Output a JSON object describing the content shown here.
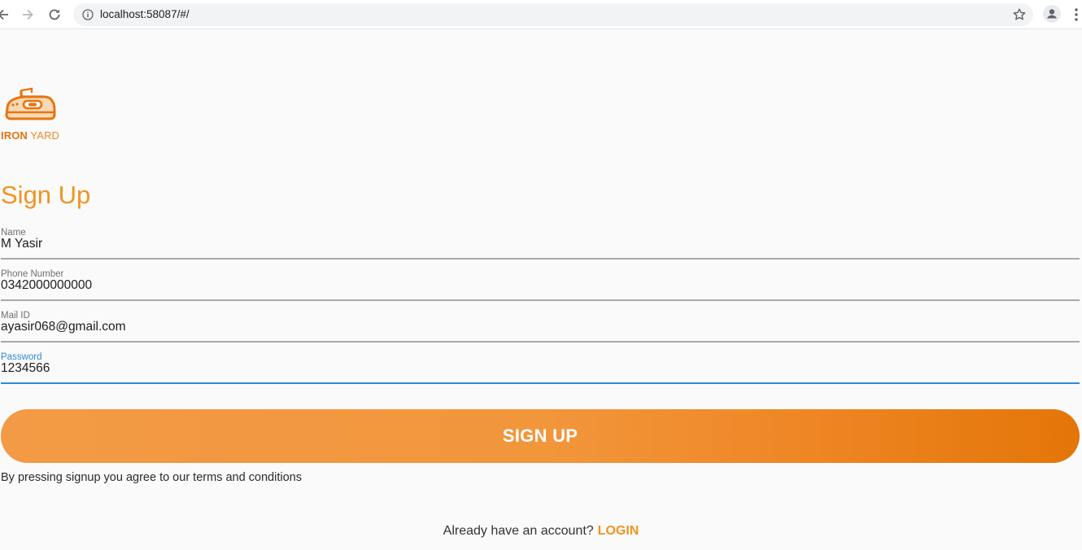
{
  "browser": {
    "url": "localhost:58087/#/",
    "icons": [
      "back-arrow-icon",
      "forward-arrow-icon",
      "reload-icon",
      "info-icon",
      "star-icon",
      "profile-icon",
      "more-menu-icon"
    ]
  },
  "brand": {
    "word1": "IRON",
    "word2": "YARD",
    "logo_icon": "iron-icon",
    "color_primary": "#e67510",
    "color_accent": "#f0941f"
  },
  "page": {
    "title": "Sign Up"
  },
  "form": {
    "name": {
      "label": "Name",
      "value": "M Yasir"
    },
    "phone": {
      "label": "Phone Number",
      "value": "0342000000000"
    },
    "mail": {
      "label": "Mail ID",
      "value": "ayasir068@gmail.com"
    },
    "password": {
      "label": "Password",
      "value": "1234566",
      "focused": true,
      "focus_color": "#2d8ad6"
    }
  },
  "actions": {
    "signup_label": "SIGN UP",
    "terms_text": "By pressing signup you agree to our terms and conditions",
    "login_prompt": "Already have an account?",
    "login_link": "LOGIN"
  }
}
